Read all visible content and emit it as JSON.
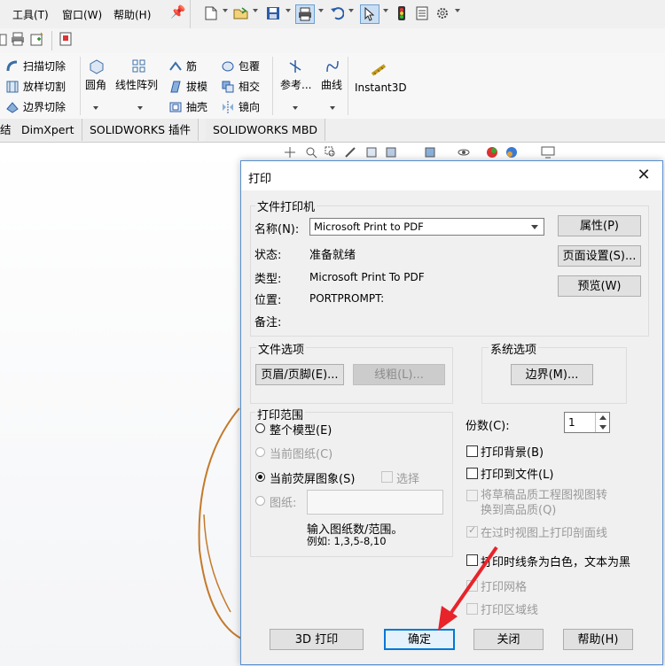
{
  "menubar": {
    "items": [
      "工具(T)",
      "窗口(W)",
      "帮助(H)"
    ]
  },
  "ribbon": {
    "sweep_cut": "扫描切除",
    "loft_cut": "放样切割",
    "boundary_cut": "边界切除",
    "fillet": "圆角",
    "linear_pattern": "线性阵列",
    "rib": "筋",
    "draft": "拔模",
    "shell": "抽壳",
    "wrap": "包覆",
    "intersect": "相交",
    "mirror": "镜向",
    "reference": "参考...",
    "curves": "曲线",
    "instant3d": "Instant3D"
  },
  "tabs": [
    "结",
    "DimXpert",
    "SOLIDWORKS 插件",
    "SOLIDWORKS MBD"
  ],
  "dialog": {
    "title": "打印",
    "printer_group": "文件打印机",
    "name_label": "名称(N):",
    "printer_name": "Microsoft Print to PDF",
    "status_label": "状态:",
    "status_value": "准备就绪",
    "type_label": "类型:",
    "type_value": "Microsoft Print To PDF",
    "location_label": "位置:",
    "location_value": "PORTPROMPT:",
    "comment_label": "备注:",
    "properties_btn": "属性(P)",
    "page_setup_btn": "页面设置(S)...",
    "preview_btn": "预览(W)",
    "doc_options_group": "文件选项",
    "header_footer_btn": "页眉/页脚(E)...",
    "line_weight_btn": "线粗(L)...",
    "sys_options_group": "系统选项",
    "margins_btn": "边界(M)...",
    "print_range_group": "打印范围",
    "whole_model": "整个模型(E)",
    "current_sheet": "当前图纸(C)",
    "current_screen": "当前荧屏图象(S)",
    "selection": "选择",
    "sheets": "图纸:",
    "sheets_hint1": "输入图纸数/范围。",
    "sheets_hint2": "例如: 1,3,5-8,10",
    "copies_label": "份数(C):",
    "copies_value": "1",
    "print_background": "打印背景(B)",
    "print_to_file": "打印到文件(L)",
    "convert_draft_line1": "将草稿品质工程图视图转",
    "convert_draft_line2": "换到高品质(Q)",
    "print_crosshatch": "在过时视图上打印剖面线",
    "print_lines_white": "打印时线条为白色，文本为黑",
    "print_grid": "打印网格",
    "print_zones": "打印区域线",
    "print3d_btn": "3D 打印",
    "ok_btn": "确定",
    "close_btn": "关闭",
    "help_btn": "帮助(H)"
  },
  "colors": {
    "dialog_border": "#5a8fcf",
    "default_button_border": "#0078d7",
    "annotation_arrow": "#e8232a",
    "model_edge": "#c47a2a"
  }
}
